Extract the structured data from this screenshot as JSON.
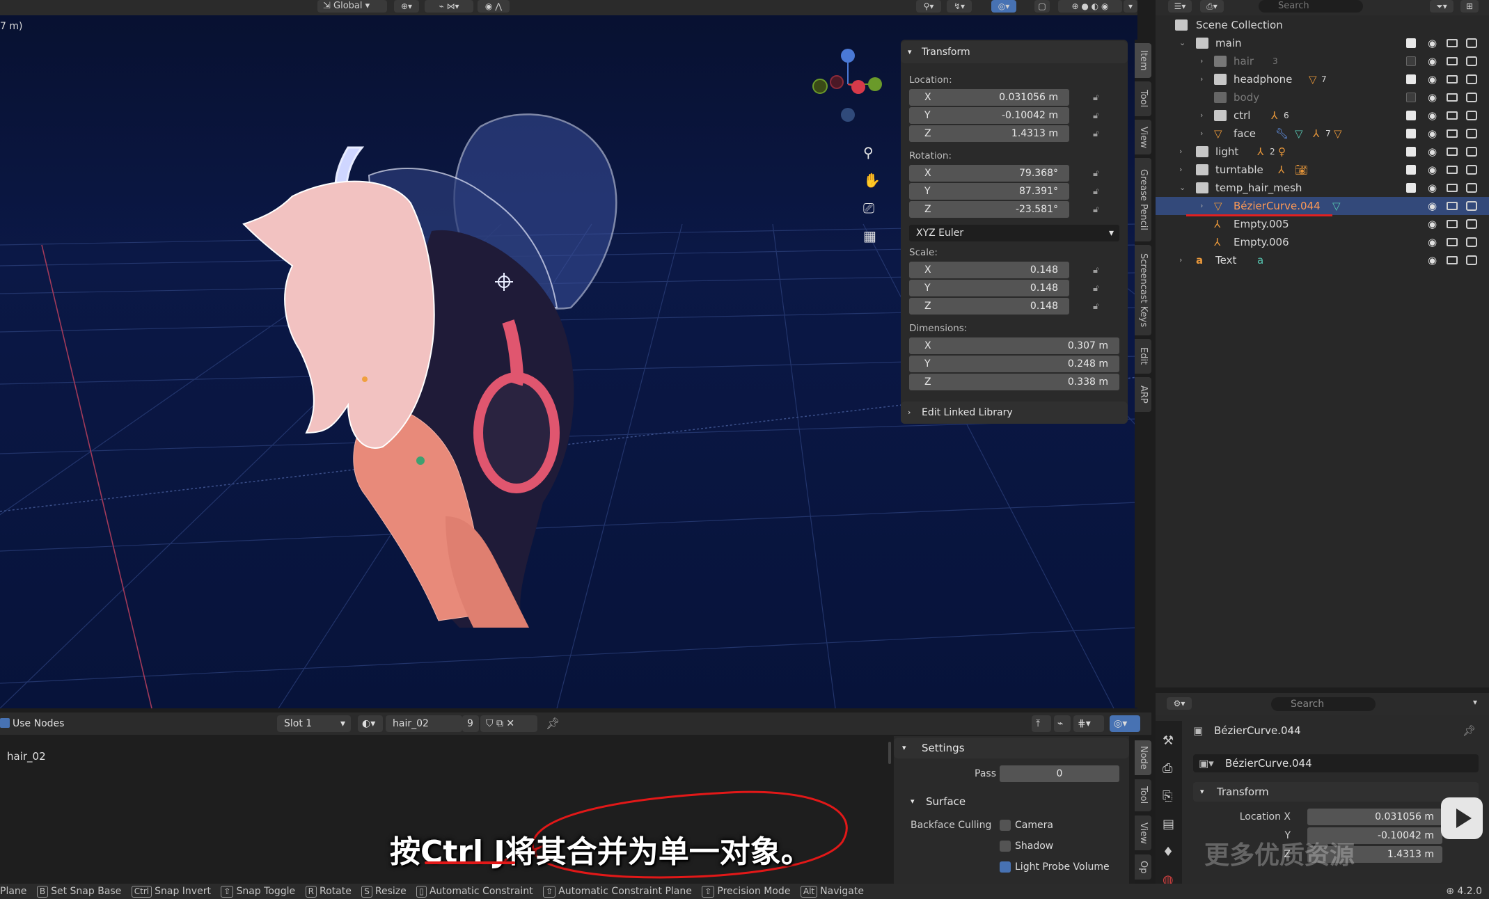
{
  "header": {
    "transform_orientation": "Global",
    "viewport_info": "7 m)"
  },
  "npanel": {
    "transform_title": "Transform",
    "location_label": "Location:",
    "location": [
      {
        "axis": "X",
        "value": "0.031056 m"
      },
      {
        "axis": "Y",
        "value": "-0.10042 m"
      },
      {
        "axis": "Z",
        "value": "1.4313 m"
      }
    ],
    "rotation_label": "Rotation:",
    "rotation": [
      {
        "axis": "X",
        "value": "79.368°"
      },
      {
        "axis": "Y",
        "value": "87.391°"
      },
      {
        "axis": "Z",
        "value": "-23.581°"
      }
    ],
    "rotation_mode": "XYZ Euler",
    "scale_label": "Scale:",
    "scale": [
      {
        "axis": "X",
        "value": "0.148"
      },
      {
        "axis": "Y",
        "value": "0.148"
      },
      {
        "axis": "Z",
        "value": "0.148"
      }
    ],
    "dimensions_label": "Dimensions:",
    "dimensions": [
      {
        "axis": "X",
        "value": "0.307 m"
      },
      {
        "axis": "Y",
        "value": "0.248 m"
      },
      {
        "axis": "Z",
        "value": "0.338 m"
      }
    ],
    "edit_linked_library": "Edit Linked Library",
    "tabs": [
      "Item",
      "Tool",
      "View",
      "Grease Pencil",
      "Screencast Keys",
      "Edit",
      "ARP"
    ]
  },
  "outliner": {
    "search_placeholder": "Search",
    "scene_collection": "Scene Collection",
    "rows": [
      {
        "name": "main"
      },
      {
        "name": "hair",
        "badge": "3"
      },
      {
        "name": "headphone",
        "badge": "7"
      },
      {
        "name": "body"
      },
      {
        "name": "ctrl",
        "badge": "6"
      },
      {
        "name": "face",
        "badge": "7"
      },
      {
        "name": "light",
        "badge": "2"
      },
      {
        "name": "turntable"
      },
      {
        "name": "temp_hair_mesh"
      },
      {
        "name": "BézierCurve.044"
      },
      {
        "name": "Empty.005"
      },
      {
        "name": "Empty.006"
      },
      {
        "name": "Text"
      }
    ]
  },
  "properties": {
    "search_placeholder": "Search",
    "object_name": "BézierCurve.044",
    "data_name": "BézierCurve.044",
    "transform_title": "Transform",
    "location_x_label": "Location X",
    "location_y_label": "Y",
    "location_z_label": "Z",
    "location_x": "0.031056 m",
    "location_y": "-0.10042 m",
    "location_z": "1.4313 m",
    "version": "4.2.0"
  },
  "material": {
    "use_nodes": "Use Nodes",
    "slot": "Slot 1",
    "material_name": "hair_02",
    "users": "9",
    "body_label": "hair_02",
    "settings_title": "Settings",
    "pass_index_label": "Pass Index",
    "pass_index_value": "0",
    "surface_title": "Surface",
    "backface_culling_label": "Backface Culling",
    "camera_label": "Camera",
    "shadow_label": "Shadow",
    "light_probe_label": "Light Probe Volume",
    "side_tabs": [
      "Node",
      "Tool",
      "View",
      "Op"
    ]
  },
  "status_bar": [
    {
      "key": "",
      "label": "Plane"
    },
    {
      "key": "B",
      "label": "Set Snap Base"
    },
    {
      "key": "Ctrl",
      "label": "Snap Invert"
    },
    {
      "key": "⇧",
      "label": "Snap Toggle"
    },
    {
      "key": "R",
      "label": "Rotate"
    },
    {
      "key": "S",
      "label": "Resize"
    },
    {
      "key": "",
      "label": "Automatic Constraint"
    },
    {
      "key": "⇧",
      "label": "Automatic Constraint Plane"
    },
    {
      "key": "⇧",
      "label": "Precision Mode"
    },
    {
      "key": "Alt",
      "label": "Navigate"
    }
  ],
  "subtitle": "按Ctrl J将其合并为单一对象。",
  "watermark": "更多优质资源"
}
